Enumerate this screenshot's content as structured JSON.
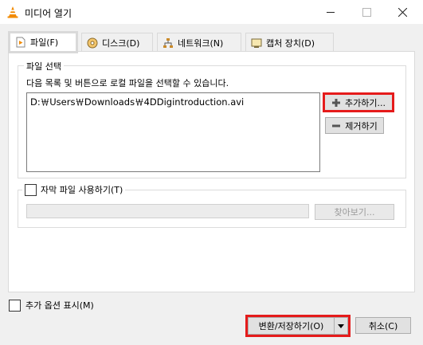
{
  "window": {
    "title": "미디어 열기"
  },
  "tabs": [
    {
      "label": "파일(F)",
      "icon": "file-play-icon"
    },
    {
      "label": "디스크(D)",
      "icon": "disc-icon"
    },
    {
      "label": "네트워크(N)",
      "icon": "network-icon"
    },
    {
      "label": "캡처 장치(D)",
      "icon": "capture-device-icon"
    }
  ],
  "file_selection": {
    "group_label": "파일 선택",
    "description": "다음 목록 및 버튼으로 로컬 파일을 선택할 수 있습니다.",
    "files": [
      "D:￦Users￦Downloads￦4DDigintroduction.avi"
    ],
    "add_button": "추가하기...",
    "remove_button": "제거하기"
  },
  "subtitle": {
    "checkbox_label": "자막 파일 사용하기(T)",
    "browse_button": "찾아보기..."
  },
  "footer": {
    "more_options_label": "추가 옵션 표시(M)",
    "convert_button": "변환/저장하기(O)",
    "cancel_button": "취소(C)"
  },
  "colors": {
    "highlight": "#e51b1b",
    "vlc_orange": "#f28a00"
  }
}
